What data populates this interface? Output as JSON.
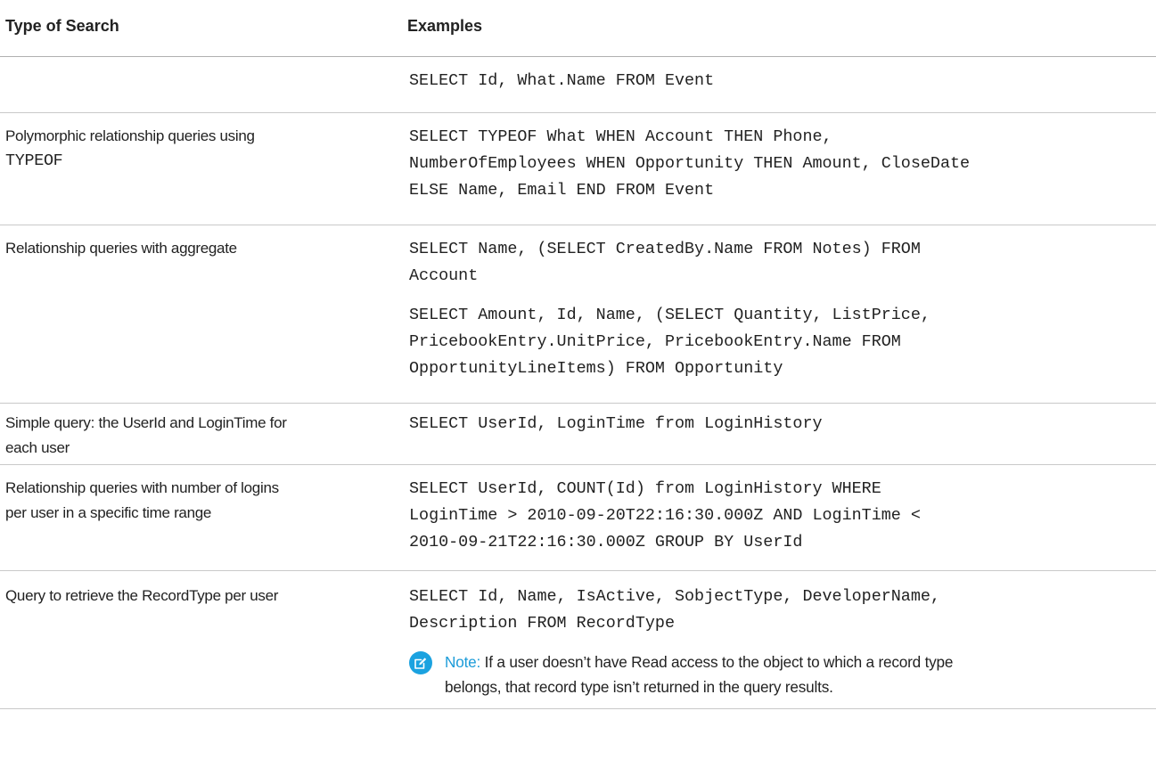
{
  "table": {
    "headers": {
      "type": "Type of Search",
      "examples": "Examples"
    },
    "rows": [
      {
        "type_lines": [],
        "examples": [
          [
            "SELECT Id, What.Name FROM Event"
          ]
        ]
      },
      {
        "type_lines": [
          "Polymorphic relationship queries using"
        ],
        "type_code": "TYPEOF",
        "examples": [
          [
            "SELECT TYPEOF What WHEN Account THEN Phone,",
            "NumberOfEmployees WHEN Opportunity THEN Amount, CloseDate",
            "ELSE Name, Email END FROM Event"
          ]
        ]
      },
      {
        "type_lines": [
          "Relationship queries with aggregate"
        ],
        "examples": [
          [
            "SELECT Name, (SELECT CreatedBy.Name FROM Notes) FROM",
            "Account"
          ],
          [
            "SELECT Amount, Id, Name, (SELECT Quantity, ListPrice,",
            "PricebookEntry.UnitPrice, PricebookEntry.Name FROM",
            "OpportunityLineItems) FROM Opportunity"
          ]
        ]
      },
      {
        "type_lines": [
          "Simple query: the UserId and LoginTime for",
          "each user"
        ],
        "examples": [
          [
            "SELECT UserId, LoginTime from LoginHistory"
          ]
        ]
      },
      {
        "type_lines": [
          "Relationship queries with number of logins",
          "per user in a specific time range"
        ],
        "examples": [
          [
            "SELECT UserId, COUNT(Id) from LoginHistory WHERE",
            "LoginTime > 2010-09-20T22:16:30.000Z AND LoginTime <",
            "2010-09-21T22:16:30.000Z GROUP BY UserId"
          ]
        ]
      },
      {
        "type_lines": [
          "Query to retrieve the RecordType per user"
        ],
        "examples": [
          [
            "SELECT Id, Name, IsActive, SobjectType, DeveloperName,",
            "Description FROM RecordType"
          ]
        ],
        "note": {
          "label": "Note:",
          "lines": [
            "If a user doesn’t have Read access to the object to which a record type",
            "belongs, that record type isn’t returned in the query results."
          ],
          "icon": "edit-note-icon"
        }
      }
    ]
  },
  "colors": {
    "accent": "#1ba2e0",
    "text": "#222222",
    "divider": "#c9c9c9"
  }
}
